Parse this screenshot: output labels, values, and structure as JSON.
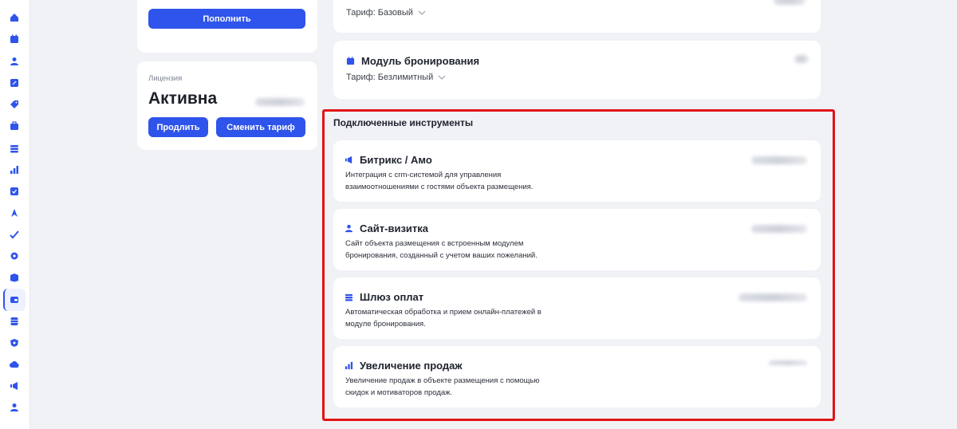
{
  "sidebar": {
    "icons": [
      "home-icon",
      "calendar-icon",
      "user-icon",
      "percent-icon",
      "tag-icon",
      "briefcase-icon",
      "stack-icon",
      "bar-chart-icon",
      "checkbox-icon",
      "rocket-icon",
      "check-icon",
      "gear-icon",
      "box-icon",
      "wallet-icon",
      "database-icon",
      "shield-icon",
      "cloud-icon",
      "megaphone-icon",
      "profile-icon"
    ],
    "active_index": 13
  },
  "balance": {
    "topup_label": "Пополнить"
  },
  "license": {
    "caption": "Лицензия",
    "status": "Активна",
    "extend_label": "Продлить",
    "change_tariff_label": "Сменить тариф"
  },
  "modules": [
    {
      "tariff": "Тариф: Базовый"
    },
    {
      "title": "Модуль бронирования",
      "tariff": "Тариф: Безлимитный"
    }
  ],
  "tools": {
    "heading": "Подключенные инструменты",
    "items": [
      {
        "title": "Битрикс / Амо",
        "desc": "Интеграция с crm-системой для управления взаимоотношениями с гостями объекта размещения.",
        "icon": "megaphone-icon"
      },
      {
        "title": "Сайт-визитка",
        "desc": "Сайт объекта размещения с встроенным модулем бронирования, созданный с учетом ваших пожеланий.",
        "icon": "user-icon"
      },
      {
        "title": "Шлюз оплат",
        "desc": "Автоматическая обработка и прием онлайн-платежей в модуле бронирования.",
        "icon": "stack-icon"
      },
      {
        "title": "Увеличение продаж",
        "desc": "Увеличение продаж в объекте размещения с помощью скидок и мотиваторов продаж.",
        "icon": "bar-chart-icon"
      }
    ]
  },
  "colors": {
    "accent": "#2f54eb",
    "highlight": "#e01414",
    "background": "#f1f2f6"
  }
}
